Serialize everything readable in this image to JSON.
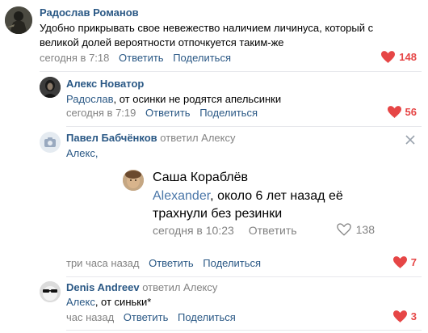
{
  "comments": [
    {
      "author": "Радослав Романов",
      "text_line1": "Удобно прикрывать свое невежество наличием личинуса, который с",
      "text_line2": "великой долей вероятности отпочкуется таким-же",
      "time": "сегодня в 7:18",
      "reply": "Ответить",
      "share": "Поделиться",
      "likes": "148"
    },
    {
      "author": "Алекс Новатор",
      "mention": "Радослав",
      "text": ", от осинки не родятся апельсинки",
      "time": "сегодня в 7:19",
      "reply": "Ответить",
      "share": "Поделиться",
      "likes": "56"
    },
    {
      "author": "Павел Бабчёнков",
      "replied_to": "ответил Алексу",
      "mention": "Алекс,",
      "time": "три часа назад",
      "reply": "Ответить",
      "share": "Поделиться",
      "likes": "7",
      "embedded": {
        "author": "Саша Кораблёв",
        "mention": "Alexander",
        "text_line1": ", около 6 лет назад её",
        "text_line2": "трахнули без резинки",
        "time": "сегодня в 10:23",
        "reply": "Ответить",
        "likes": "138"
      }
    },
    {
      "author": "Denis Andreev",
      "replied_to": "ответил Алексу",
      "mention": "Алекс",
      "text": ", от синьки*",
      "time": "час назад",
      "reply": "Ответить",
      "share": "Поделиться",
      "likes": "3"
    }
  ],
  "colors": {
    "link": "#2a5885",
    "meta": "#828282",
    "like": "#e64646",
    "embedded_link": "#4a76a8"
  }
}
